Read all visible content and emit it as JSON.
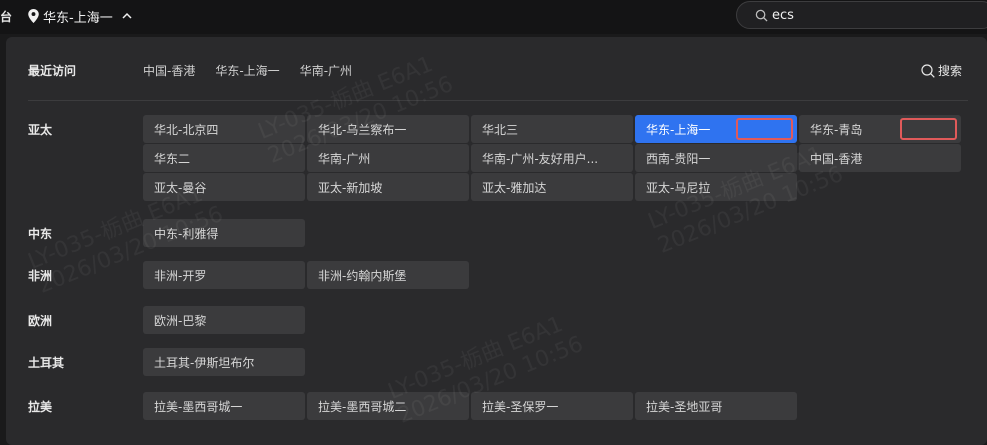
{
  "topbar": {
    "left_cut_label": "台",
    "region_label": "华东-上海一",
    "search_value": "ecs"
  },
  "panel": {
    "recent_label": "最近访问",
    "recent_links": [
      "中国-香港",
      "华东-上海一",
      "华南-广州"
    ],
    "search_label": "搜索"
  },
  "groups": [
    {
      "label": "亚太",
      "items": [
        "华北-北京四",
        "华北-乌兰察布一",
        "华北三",
        "华东-上海一",
        "华东-青岛",
        "华东二",
        "华南-广州",
        "华南-广州-友好用户...",
        "西南-贵阳一",
        "中国-香港",
        "亚太-曼谷",
        "亚太-新加坡",
        "亚太-雅加达",
        "亚太-马尼拉"
      ],
      "active": "华东-上海一"
    },
    {
      "label": "中东",
      "items": [
        "中东-利雅得"
      ]
    },
    {
      "label": "非洲",
      "items": [
        "非洲-开罗",
        "非洲-约翰内斯堡"
      ]
    },
    {
      "label": "欧洲",
      "items": [
        "欧洲-巴黎"
      ]
    },
    {
      "label": "土耳其",
      "items": [
        "土耳其-伊斯坦布尔"
      ]
    },
    {
      "label": "拉美",
      "items": [
        "拉美-墨西哥城一",
        "拉美-墨西哥城二",
        "拉美-圣保罗一",
        "拉美-圣地亚哥"
      ]
    }
  ],
  "watermark": {
    "line1": "LY-035-栃曲 E6A1",
    "line2": "2026/03/20 10:56"
  },
  "colors": {
    "accent": "#2f73f0",
    "highlight_box": "#e05a5a",
    "panel_bg": "#2a2a2c",
    "chip_bg": "#3b3b3d"
  },
  "icons": {
    "region": "map-pin-icon",
    "expand": "chevron-up-icon",
    "search": "search-icon"
  }
}
